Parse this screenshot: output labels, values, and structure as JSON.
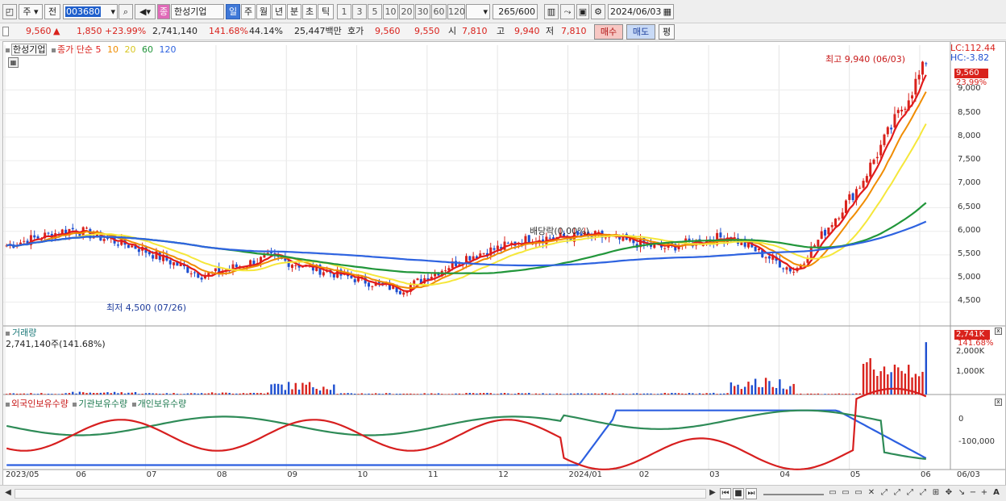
{
  "toolbar": {
    "market": "주",
    "prev": "전",
    "code": "003680",
    "badge": "종",
    "name": "한성기업",
    "periods": [
      "일",
      "주",
      "월",
      "년",
      "분",
      "초",
      "틱"
    ],
    "active_period": "일",
    "minutes": [
      "1",
      "3",
      "5",
      "10",
      "20",
      "30",
      "60",
      "120"
    ],
    "count": "265",
    "count_total": "/600",
    "date": "2024/06/03"
  },
  "quote": {
    "price": "9,560",
    "arrow": "▲",
    "change": "1,850",
    "change_pct": "+23.99%",
    "volume": "2,741,140",
    "vol_ratio": "141.68%",
    "turnover": "44.14%",
    "amount": "25,447백만",
    "ask_label": "호가",
    "ask": "9,560",
    "bid": "9,550",
    "open_label": "시",
    "open": "7,810",
    "high_label": "고",
    "high": "9,940",
    "low_label": "저",
    "low": "7,810",
    "buy": "매수",
    "sell": "매도",
    "eval": "평"
  },
  "price_pane": {
    "stock_label": "한성기업",
    "ma_label": "종가 단순",
    "ma_periods": [
      "5",
      "10",
      "20",
      "60",
      "120"
    ],
    "lc": "LC:112.44",
    "hc": "HC:-3.82",
    "high_note": "최고 9,940 (06/03)",
    "low_note": "최저 4,500 (07/26)",
    "dividend_note": "배당락(0.00%)",
    "last_price": "9,560",
    "last_pct": "23.99%",
    "axis": [
      "9,000",
      "8,500",
      "8,000",
      "7,500",
      "7,000",
      "6,500",
      "6,000",
      "5,500",
      "5,000",
      "4,500"
    ]
  },
  "volume_pane": {
    "title": "거래량",
    "value": "2,741,140주(141.68%)",
    "last": "2,741K",
    "last_pct": "141.68%",
    "axis": [
      "2,000K",
      "1,000K"
    ]
  },
  "holder_pane": {
    "series": [
      "외국인보유수량",
      "기관보유수량",
      "개인보유수량"
    ],
    "axis": [
      "0",
      "-100,000"
    ]
  },
  "x_axis": [
    "2023/05",
    "06",
    "07",
    "08",
    "09",
    "10",
    "11",
    "12",
    "2024/01",
    "02",
    "03",
    "04",
    "05",
    "06",
    "06/03"
  ],
  "colors": {
    "up": "#d9221c",
    "down": "#1e4fd0",
    "ma5": "#e21b1b",
    "ma10": "#f08c00",
    "ma20": "#f5e73a",
    "ma60": "#21963a",
    "ma120": "#2e63e0",
    "foreign": "#d71f1f",
    "institution": "#2e8b57",
    "individual": "#2c5fe0"
  },
  "chart_data": {
    "type": "line",
    "title": "한성기업",
    "last_close": 9560,
    "high": {
      "value": 9940,
      "date": "06/03"
    },
    "low": {
      "value": 4500,
      "date": "07/26"
    },
    "ylim": [
      4300,
      9950
    ],
    "months": [
      {
        "label": "2023/05",
        "close": 5700,
        "volume_k": 80
      },
      {
        "label": "06",
        "close": 6050,
        "volume_k": 150
      },
      {
        "label": "07",
        "close": 5650,
        "volume_k": 90
      },
      {
        "label": "08",
        "close": 5050,
        "volume_k": 120
      },
      {
        "label": "09",
        "close": 5450,
        "volume_k": 700
      },
      {
        "label": "10",
        "close": 5100,
        "volume_k": 80
      },
      {
        "label": "11",
        "close": 4750,
        "volume_k": 70
      },
      {
        "label": "12",
        "close": 5450,
        "volume_k": 90
      },
      {
        "label": "2024/01",
        "close": 5850,
        "volume_k": 70
      },
      {
        "label": "02",
        "close": 5900,
        "volume_k": 80
      },
      {
        "label": "03",
        "close": 5650,
        "volume_k": 90
      },
      {
        "label": "04",
        "close": 5900,
        "volume_k": 900
      },
      {
        "label": "05",
        "close": 5150,
        "volume_k": 60
      },
      {
        "label": "06",
        "close": 7000,
        "volume_k": 2200
      },
      {
        "label": "06/03",
        "close": 9560,
        "volume_k": 2741
      }
    ]
  }
}
